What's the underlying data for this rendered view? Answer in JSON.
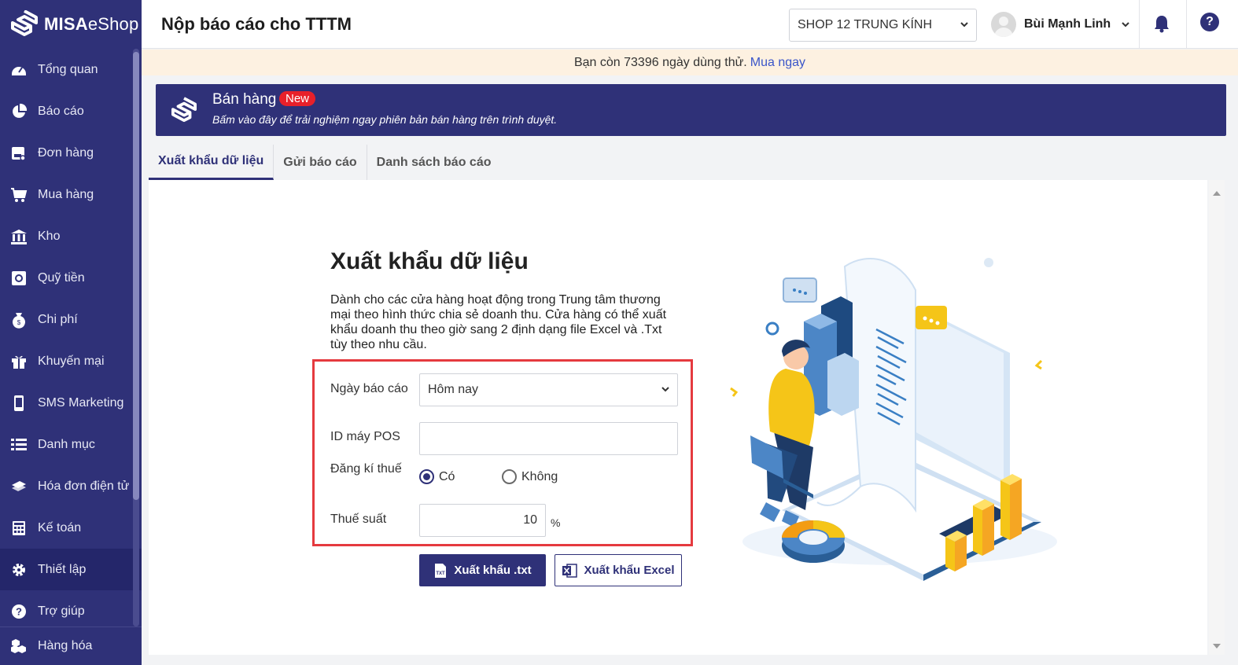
{
  "app": {
    "logo_bold": "MISA",
    "logo_rest": "eShop",
    "page_title": "Nộp báo cáo cho TTTM"
  },
  "sidebar": {
    "items": [
      {
        "label": "Tổng quan",
        "icon": "dashboard-icon"
      },
      {
        "label": "Báo cáo",
        "icon": "pie-chart-icon"
      },
      {
        "label": "Đơn hàng",
        "icon": "order-icon"
      },
      {
        "label": "Mua hàng",
        "icon": "cart-icon"
      },
      {
        "label": "Kho",
        "icon": "warehouse-icon"
      },
      {
        "label": "Quỹ tiền",
        "icon": "safe-icon"
      },
      {
        "label": "Chi phí",
        "icon": "money-bag-icon"
      },
      {
        "label": "Khuyến mại",
        "icon": "gift-icon"
      },
      {
        "label": "SMS Marketing",
        "icon": "phone-icon"
      },
      {
        "label": "Danh mục",
        "icon": "list-icon"
      },
      {
        "label": "Hóa đơn điện tử",
        "icon": "invoice-icon"
      },
      {
        "label": "Kế toán",
        "icon": "calculator-icon"
      },
      {
        "label": "Thiết lập",
        "icon": "gear-icon"
      },
      {
        "label": "Trợ giúp",
        "icon": "help-icon"
      }
    ],
    "bottom_label": "Hàng hóa"
  },
  "header": {
    "shop_selected": "SHOP 12 TRUNG KÍNH",
    "user_name": "Bùi Mạnh Linh"
  },
  "trial": {
    "text": "Bạn còn 73396 ngày dùng thử.",
    "link": "Mua ngay"
  },
  "banner": {
    "title": "Bán hàng",
    "badge": "New",
    "subtitle": "Bấm vào đây để trải nghiệm ngay phiên bản bán hàng trên trình duyệt."
  },
  "tabs": [
    "Xuất khẩu dữ liệu",
    "Gửi báo cáo",
    "Danh sách báo cáo"
  ],
  "export": {
    "title": "Xuất khẩu dữ liệu",
    "description": "Dành cho các cửa hàng hoạt động trong Trung tâm thương mại theo hình thức chia sẻ doanh thu. Cửa hàng có thể xuất khẩu doanh thu theo giờ sang 2 định dạng file Excel và .Txt tùy theo nhu cầu.",
    "form": {
      "date_label": "Ngày báo cáo",
      "date_value": "Hôm nay",
      "pos_label": "ID máy POS",
      "pos_value": "",
      "tax_label": "Đăng kí thuế",
      "tax_yes": "Có",
      "tax_no": "Không",
      "rate_label": "Thuế suất",
      "rate_value": "10",
      "rate_unit": "%"
    },
    "btn_txt": "Xuất khẩu .txt",
    "btn_excel": "Xuất khẩu Excel"
  }
}
